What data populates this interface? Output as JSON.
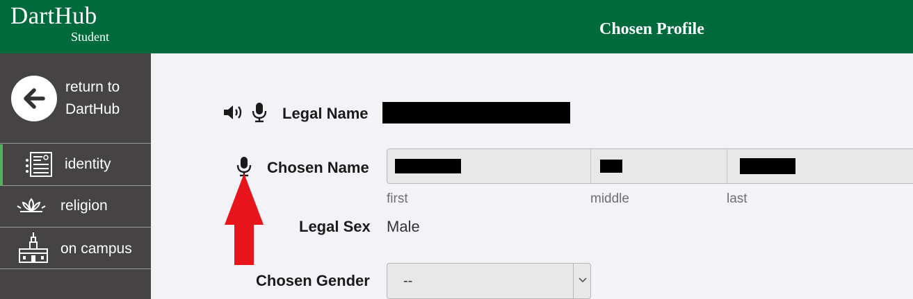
{
  "header": {
    "brand_name": "DartHub",
    "brand_sub": "Student",
    "page_title": "Chosen Profile",
    "colors": {
      "header_bg": "#006a3d",
      "sidebar_bg": "#454343",
      "active_accent": "#52b35b",
      "annotation_arrow": "#e8141c"
    }
  },
  "sidebar": {
    "return": {
      "label": "return to DartHub",
      "icon": "arrow-left-circle-icon"
    },
    "items": [
      {
        "label": "identity",
        "icon": "id-card-icon",
        "active": true
      },
      {
        "label": "religion",
        "icon": "lotus-icon",
        "active": false
      },
      {
        "label": "on campus",
        "icon": "campus-building-icon",
        "active": false
      }
    ]
  },
  "form": {
    "legal_name": {
      "label": "Legal Name",
      "icons": [
        "speaker-icon",
        "microphone-icon"
      ]
    },
    "chosen_name": {
      "label": "Chosen Name",
      "icon": "microphone-icon",
      "hints": {
        "first": "first",
        "middle": "middle",
        "last": "last"
      }
    },
    "legal_sex": {
      "label": "Legal Sex",
      "value": "Male"
    },
    "chosen_gender": {
      "label": "Chosen Gender",
      "selected": "--"
    }
  }
}
